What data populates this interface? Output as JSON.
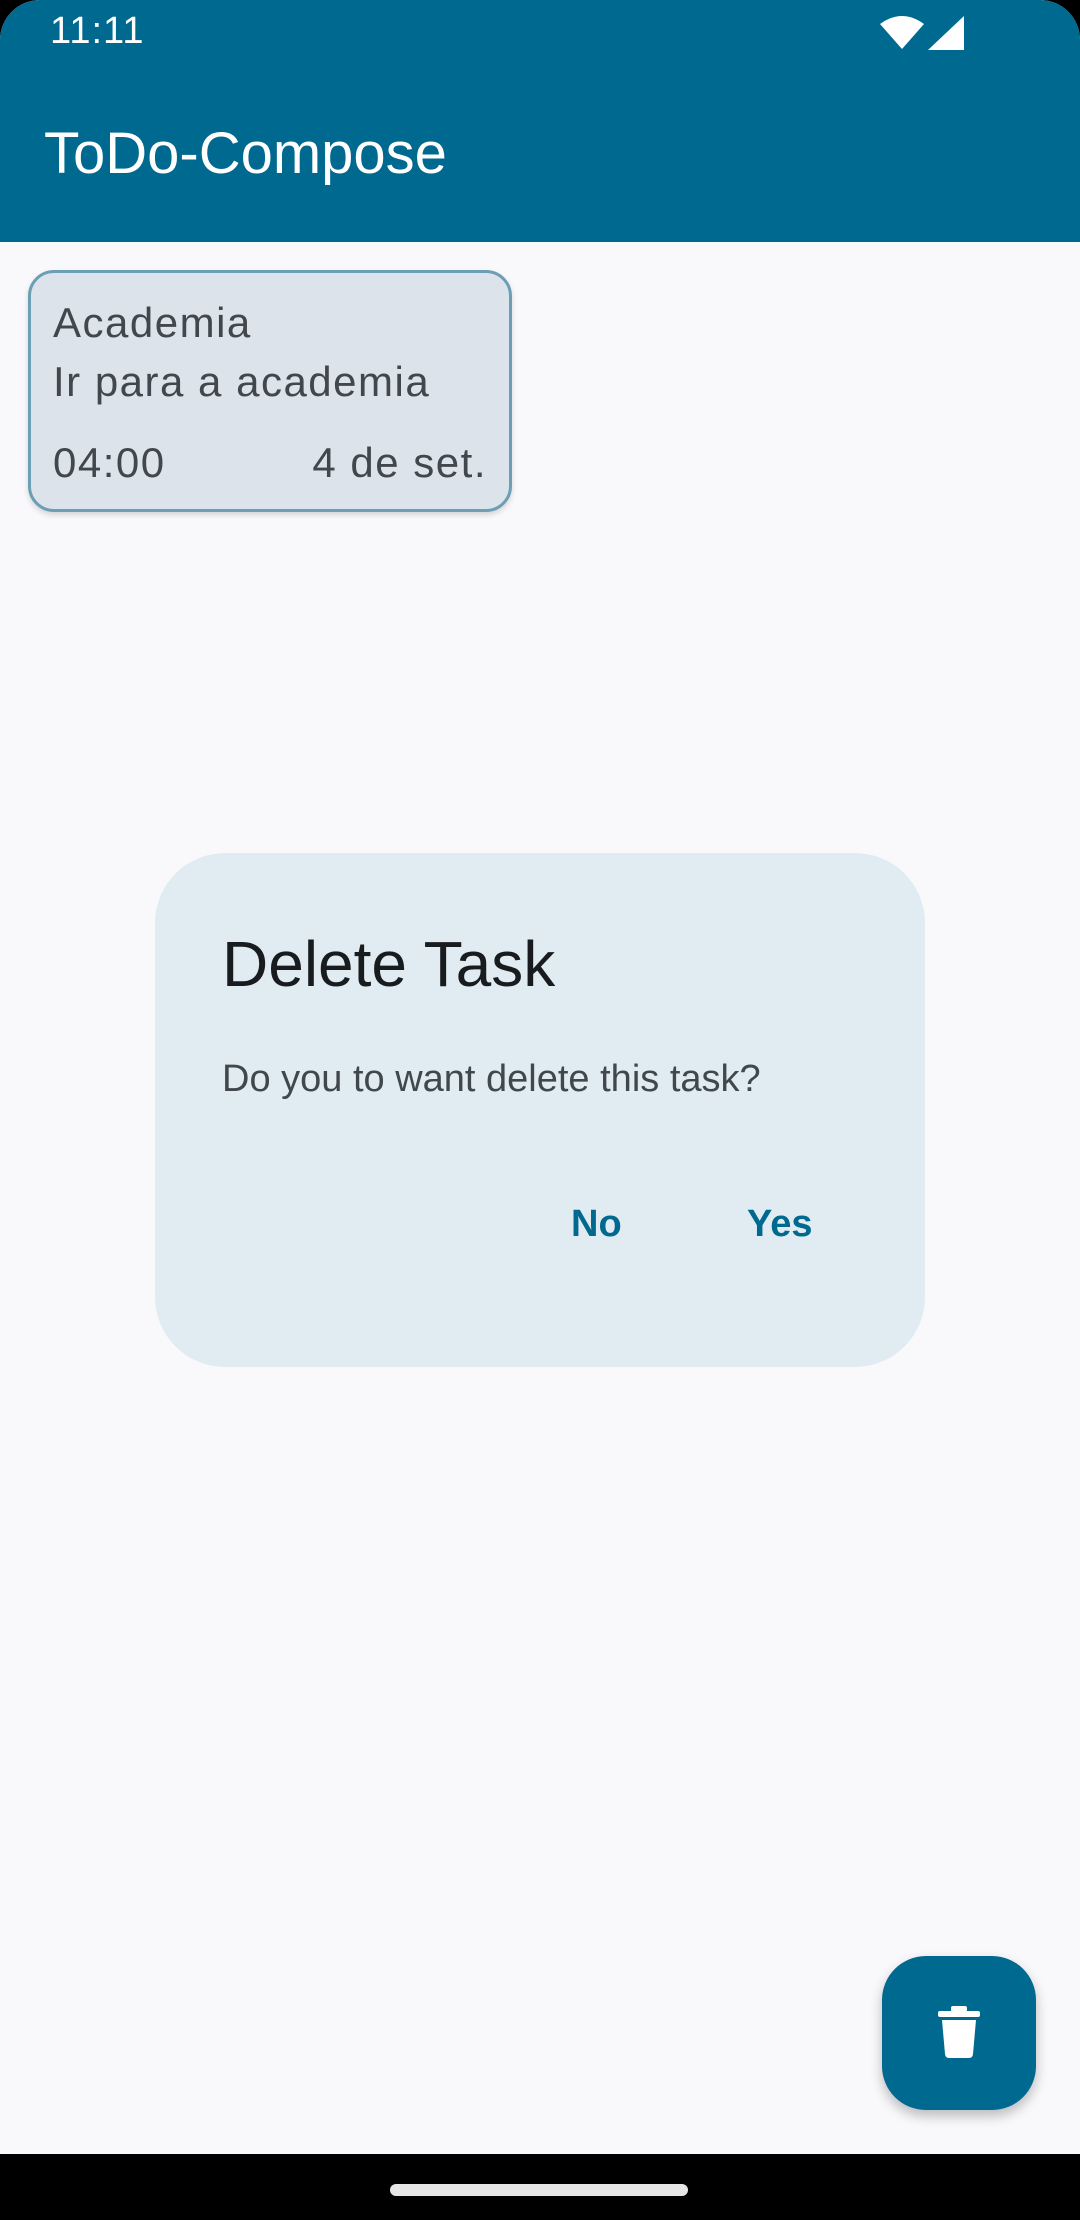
{
  "status_bar": {
    "time": "11:11",
    "icons": [
      "wifi-icon",
      "signal-icon"
    ]
  },
  "app_bar": {
    "title": "ToDo-Compose"
  },
  "tasks": [
    {
      "title": "Academia",
      "description": "Ir para a academia",
      "time": "04:00",
      "date": "4 de set."
    }
  ],
  "dialog": {
    "title": "Delete Task",
    "message": "Do you to want delete this task?",
    "dismiss_label": "No",
    "confirm_label": "Yes"
  },
  "fab": {
    "icon": "delete-icon"
  },
  "colors": {
    "primary": "#00698f",
    "background": "#f9f9fc",
    "card": "#dde3ea",
    "dialog": "#e0ecf2"
  }
}
